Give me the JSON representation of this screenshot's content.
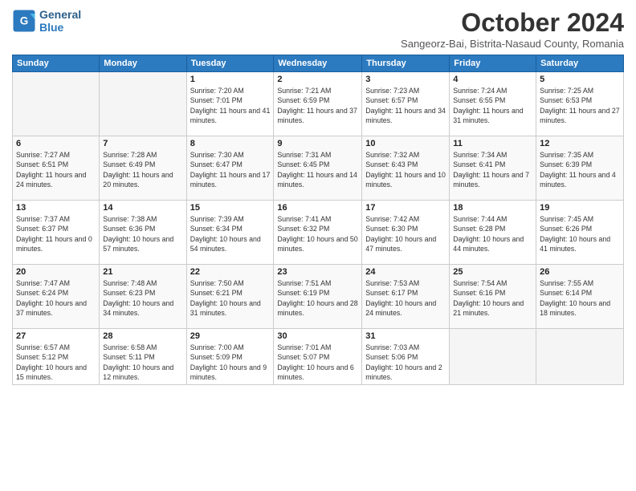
{
  "logo": {
    "line1": "General",
    "line2": "Blue"
  },
  "title": "October 2024",
  "subtitle": "Sangeorz-Bai, Bistrita-Nasaud County, Romania",
  "weekdays": [
    "Sunday",
    "Monday",
    "Tuesday",
    "Wednesday",
    "Thursday",
    "Friday",
    "Saturday"
  ],
  "weeks": [
    [
      {
        "day": "",
        "info": ""
      },
      {
        "day": "",
        "info": ""
      },
      {
        "day": "1",
        "info": "Sunrise: 7:20 AM\nSunset: 7:01 PM\nDaylight: 11 hours and 41 minutes."
      },
      {
        "day": "2",
        "info": "Sunrise: 7:21 AM\nSunset: 6:59 PM\nDaylight: 11 hours and 37 minutes."
      },
      {
        "day": "3",
        "info": "Sunrise: 7:23 AM\nSunset: 6:57 PM\nDaylight: 11 hours and 34 minutes."
      },
      {
        "day": "4",
        "info": "Sunrise: 7:24 AM\nSunset: 6:55 PM\nDaylight: 11 hours and 31 minutes."
      },
      {
        "day": "5",
        "info": "Sunrise: 7:25 AM\nSunset: 6:53 PM\nDaylight: 11 hours and 27 minutes."
      }
    ],
    [
      {
        "day": "6",
        "info": "Sunrise: 7:27 AM\nSunset: 6:51 PM\nDaylight: 11 hours and 24 minutes."
      },
      {
        "day": "7",
        "info": "Sunrise: 7:28 AM\nSunset: 6:49 PM\nDaylight: 11 hours and 20 minutes."
      },
      {
        "day": "8",
        "info": "Sunrise: 7:30 AM\nSunset: 6:47 PM\nDaylight: 11 hours and 17 minutes."
      },
      {
        "day": "9",
        "info": "Sunrise: 7:31 AM\nSunset: 6:45 PM\nDaylight: 11 hours and 14 minutes."
      },
      {
        "day": "10",
        "info": "Sunrise: 7:32 AM\nSunset: 6:43 PM\nDaylight: 11 hours and 10 minutes."
      },
      {
        "day": "11",
        "info": "Sunrise: 7:34 AM\nSunset: 6:41 PM\nDaylight: 11 hours and 7 minutes."
      },
      {
        "day": "12",
        "info": "Sunrise: 7:35 AM\nSunset: 6:39 PM\nDaylight: 11 hours and 4 minutes."
      }
    ],
    [
      {
        "day": "13",
        "info": "Sunrise: 7:37 AM\nSunset: 6:37 PM\nDaylight: 11 hours and 0 minutes."
      },
      {
        "day": "14",
        "info": "Sunrise: 7:38 AM\nSunset: 6:36 PM\nDaylight: 10 hours and 57 minutes."
      },
      {
        "day": "15",
        "info": "Sunrise: 7:39 AM\nSunset: 6:34 PM\nDaylight: 10 hours and 54 minutes."
      },
      {
        "day": "16",
        "info": "Sunrise: 7:41 AM\nSunset: 6:32 PM\nDaylight: 10 hours and 50 minutes."
      },
      {
        "day": "17",
        "info": "Sunrise: 7:42 AM\nSunset: 6:30 PM\nDaylight: 10 hours and 47 minutes."
      },
      {
        "day": "18",
        "info": "Sunrise: 7:44 AM\nSunset: 6:28 PM\nDaylight: 10 hours and 44 minutes."
      },
      {
        "day": "19",
        "info": "Sunrise: 7:45 AM\nSunset: 6:26 PM\nDaylight: 10 hours and 41 minutes."
      }
    ],
    [
      {
        "day": "20",
        "info": "Sunrise: 7:47 AM\nSunset: 6:24 PM\nDaylight: 10 hours and 37 minutes."
      },
      {
        "day": "21",
        "info": "Sunrise: 7:48 AM\nSunset: 6:23 PM\nDaylight: 10 hours and 34 minutes."
      },
      {
        "day": "22",
        "info": "Sunrise: 7:50 AM\nSunset: 6:21 PM\nDaylight: 10 hours and 31 minutes."
      },
      {
        "day": "23",
        "info": "Sunrise: 7:51 AM\nSunset: 6:19 PM\nDaylight: 10 hours and 28 minutes."
      },
      {
        "day": "24",
        "info": "Sunrise: 7:53 AM\nSunset: 6:17 PM\nDaylight: 10 hours and 24 minutes."
      },
      {
        "day": "25",
        "info": "Sunrise: 7:54 AM\nSunset: 6:16 PM\nDaylight: 10 hours and 21 minutes."
      },
      {
        "day": "26",
        "info": "Sunrise: 7:55 AM\nSunset: 6:14 PM\nDaylight: 10 hours and 18 minutes."
      }
    ],
    [
      {
        "day": "27",
        "info": "Sunrise: 6:57 AM\nSunset: 5:12 PM\nDaylight: 10 hours and 15 minutes."
      },
      {
        "day": "28",
        "info": "Sunrise: 6:58 AM\nSunset: 5:11 PM\nDaylight: 10 hours and 12 minutes."
      },
      {
        "day": "29",
        "info": "Sunrise: 7:00 AM\nSunset: 5:09 PM\nDaylight: 10 hours and 9 minutes."
      },
      {
        "day": "30",
        "info": "Sunrise: 7:01 AM\nSunset: 5:07 PM\nDaylight: 10 hours and 6 minutes."
      },
      {
        "day": "31",
        "info": "Sunrise: 7:03 AM\nSunset: 5:06 PM\nDaylight: 10 hours and 2 minutes."
      },
      {
        "day": "",
        "info": ""
      },
      {
        "day": "",
        "info": ""
      }
    ]
  ]
}
